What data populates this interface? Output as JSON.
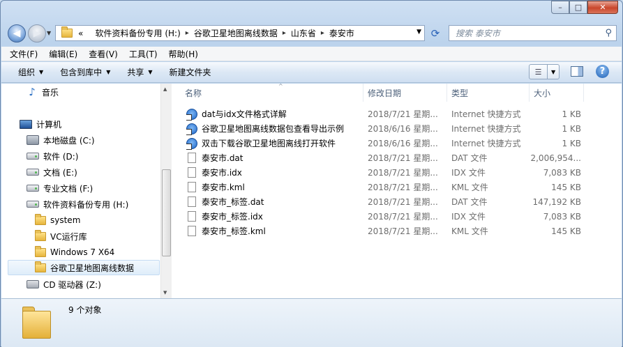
{
  "window": {
    "controls": {
      "minimize": "–",
      "maximize": "□",
      "close": "✕"
    }
  },
  "navigation": {
    "back_icon": "arrow-left",
    "forward_icon": "arrow-right",
    "address": {
      "overflow": "«",
      "crumbs": [
        "软件资料备份专用 (H:)",
        "谷歌卫星地图离线数据",
        "山东省",
        "泰安市"
      ]
    },
    "search_placeholder": "搜索 泰安市"
  },
  "menu": [
    "文件(F)",
    "编辑(E)",
    "查看(V)",
    "工具(T)",
    "帮助(H)"
  ],
  "toolbar": {
    "organize": "组织",
    "include_in_library": "包含到库中",
    "share": "共享",
    "new_folder": "新建文件夹"
  },
  "sidebar": {
    "items": [
      {
        "label": "音乐",
        "icon": "music-icon"
      },
      {
        "label": "计算机",
        "icon": "computer-icon"
      },
      {
        "label": "本地磁盘 (C:)",
        "icon": "system-drive-icon"
      },
      {
        "label": "软件 (D:)",
        "icon": "drive-icon"
      },
      {
        "label": "文档 (E:)",
        "icon": "drive-icon"
      },
      {
        "label": "专业文档 (F:)",
        "icon": "drive-icon"
      },
      {
        "label": "软件资料备份专用 (H:)",
        "icon": "drive-icon"
      },
      {
        "label": "system",
        "icon": "folder-icon"
      },
      {
        "label": "VC运行库",
        "icon": "folder-icon"
      },
      {
        "label": "Windows 7 X64",
        "icon": "folder-icon"
      },
      {
        "label": "谷歌卫星地图离线数据",
        "icon": "folder-icon",
        "selected": true
      },
      {
        "label": "CD 驱动器 (Z:)",
        "icon": "cd-drive-icon"
      }
    ]
  },
  "columns": [
    "名称",
    "修改日期",
    "类型",
    "大小"
  ],
  "files": [
    {
      "name": "dat与idx文件格式详解",
      "date": "2018/7/21 星期...",
      "type": "Internet 快捷方式",
      "size": "1 KB",
      "icon": "shortcut"
    },
    {
      "name": "谷歌卫星地图离线数据包查看导出示例",
      "date": "2018/6/16 星期...",
      "type": "Internet 快捷方式",
      "size": "1 KB",
      "icon": "shortcut"
    },
    {
      "name": "双击下载谷歌卫星地图离线打开软件",
      "date": "2018/6/16 星期...",
      "type": "Internet 快捷方式",
      "size": "1 KB",
      "icon": "shortcut"
    },
    {
      "name": "泰安市.dat",
      "date": "2018/7/21 星期...",
      "type": "DAT 文件",
      "size": "2,006,954...",
      "icon": "file"
    },
    {
      "name": "泰安市.idx",
      "date": "2018/7/21 星期...",
      "type": "IDX 文件",
      "size": "7,083 KB",
      "icon": "file"
    },
    {
      "name": "泰安市.kml",
      "date": "2018/7/21 星期...",
      "type": "KML 文件",
      "size": "145 KB",
      "icon": "file"
    },
    {
      "name": "泰安市_标签.dat",
      "date": "2018/7/21 星期...",
      "type": "DAT 文件",
      "size": "147,192 KB",
      "icon": "file"
    },
    {
      "name": "泰安市_标签.idx",
      "date": "2018/7/21 星期...",
      "type": "IDX 文件",
      "size": "7,083 KB",
      "icon": "file"
    },
    {
      "name": "泰安市_标签.kml",
      "date": "2018/7/21 星期...",
      "type": "KML 文件",
      "size": "145 KB",
      "icon": "file"
    }
  ],
  "status": {
    "count": "9 个对象"
  },
  "colors": {
    "accent": "#2a62b8",
    "selection": "#dfedfa",
    "folder": "#e6b53c"
  }
}
